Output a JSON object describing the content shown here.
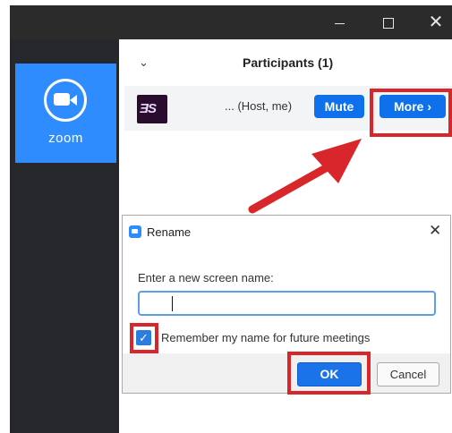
{
  "window": {
    "minimize_icon": "minimize-icon",
    "maximize_icon": "maximize-icon",
    "close_glyph": "✕"
  },
  "sidebar": {
    "app_name": "zoom",
    "brand_color": "#2f8cff",
    "icon": "zoom-camera-icon"
  },
  "participants": {
    "collapse_glyph": "⌄",
    "title": "Participants (1)",
    "list": [
      {
        "avatar_text": "ƎS",
        "name": "... (Host, me)",
        "mute_label": "Mute",
        "more_label": "More ›"
      }
    ]
  },
  "dialog": {
    "title": "Rename",
    "close_glyph": "✕",
    "prompt": "Enter a new screen name:",
    "input_value": "",
    "remember_checked": true,
    "check_glyph": "✓",
    "remember_label": "Remember my name for future meetings",
    "ok_label": "OK",
    "cancel_label": "Cancel"
  },
  "colors": {
    "accent": "#0e71eb",
    "highlight": "#d9262b",
    "sidebar_bg": "#26282c"
  }
}
